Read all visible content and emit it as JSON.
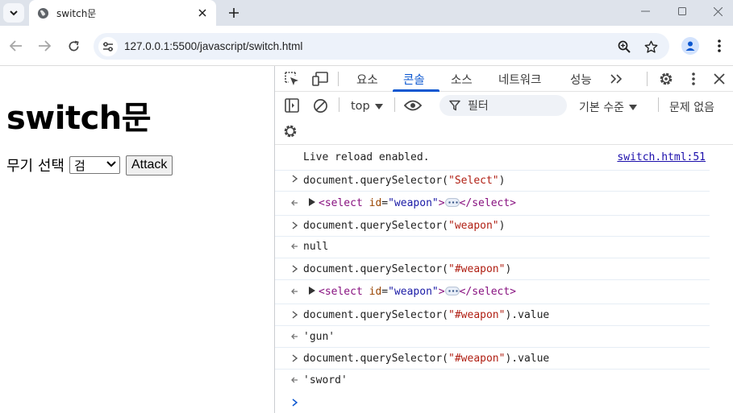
{
  "browser": {
    "tab_title": "switch문",
    "url": "127.0.0.1:5500/javascript/switch.html"
  },
  "page": {
    "heading": "switch문",
    "weapon_label": "무기 선택",
    "weapon_selected": "검",
    "attack_label": "Attack"
  },
  "devtools": {
    "tabs": [
      "요소",
      "콘솔",
      "소스",
      "네트워크",
      "성능"
    ],
    "active_tab": "콘솔",
    "context": "top",
    "filter_placeholder": "필터",
    "level": "기본 수준",
    "issues": "문제 없음"
  },
  "console": {
    "info": {
      "text": "Live reload enabled.",
      "source": "switch.html:51"
    },
    "entries": [
      {
        "input": "document.querySelector(",
        "arg": "\"Select\"",
        "close": ")"
      },
      {
        "el_open": "<select",
        "el_attr": "id",
        "el_val": "\"weapon\"",
        "el_gt": ">",
        "el_close": "</select>"
      },
      {
        "input": "document.querySelector(",
        "arg": "\"weapon\"",
        "close": ")"
      },
      {
        "result": "null"
      },
      {
        "input": "document.querySelector(",
        "arg": "\"#weapon\"",
        "close": ")"
      },
      {
        "el_open": "<select",
        "el_attr": "id",
        "el_val": "\"weapon\"",
        "el_gt": ">",
        "el_close": "</select>"
      },
      {
        "input": "document.querySelector(",
        "arg": "\"#weapon\"",
        "close": ").value"
      },
      {
        "result": "'gun'"
      },
      {
        "input": "document.querySelector(",
        "arg": "\"#weapon\"",
        "close": ").value"
      },
      {
        "result": "'sword'"
      }
    ]
  },
  "colors": {
    "accent": "#0b57d0",
    "string": "#b01f13",
    "tag": "#881280"
  }
}
